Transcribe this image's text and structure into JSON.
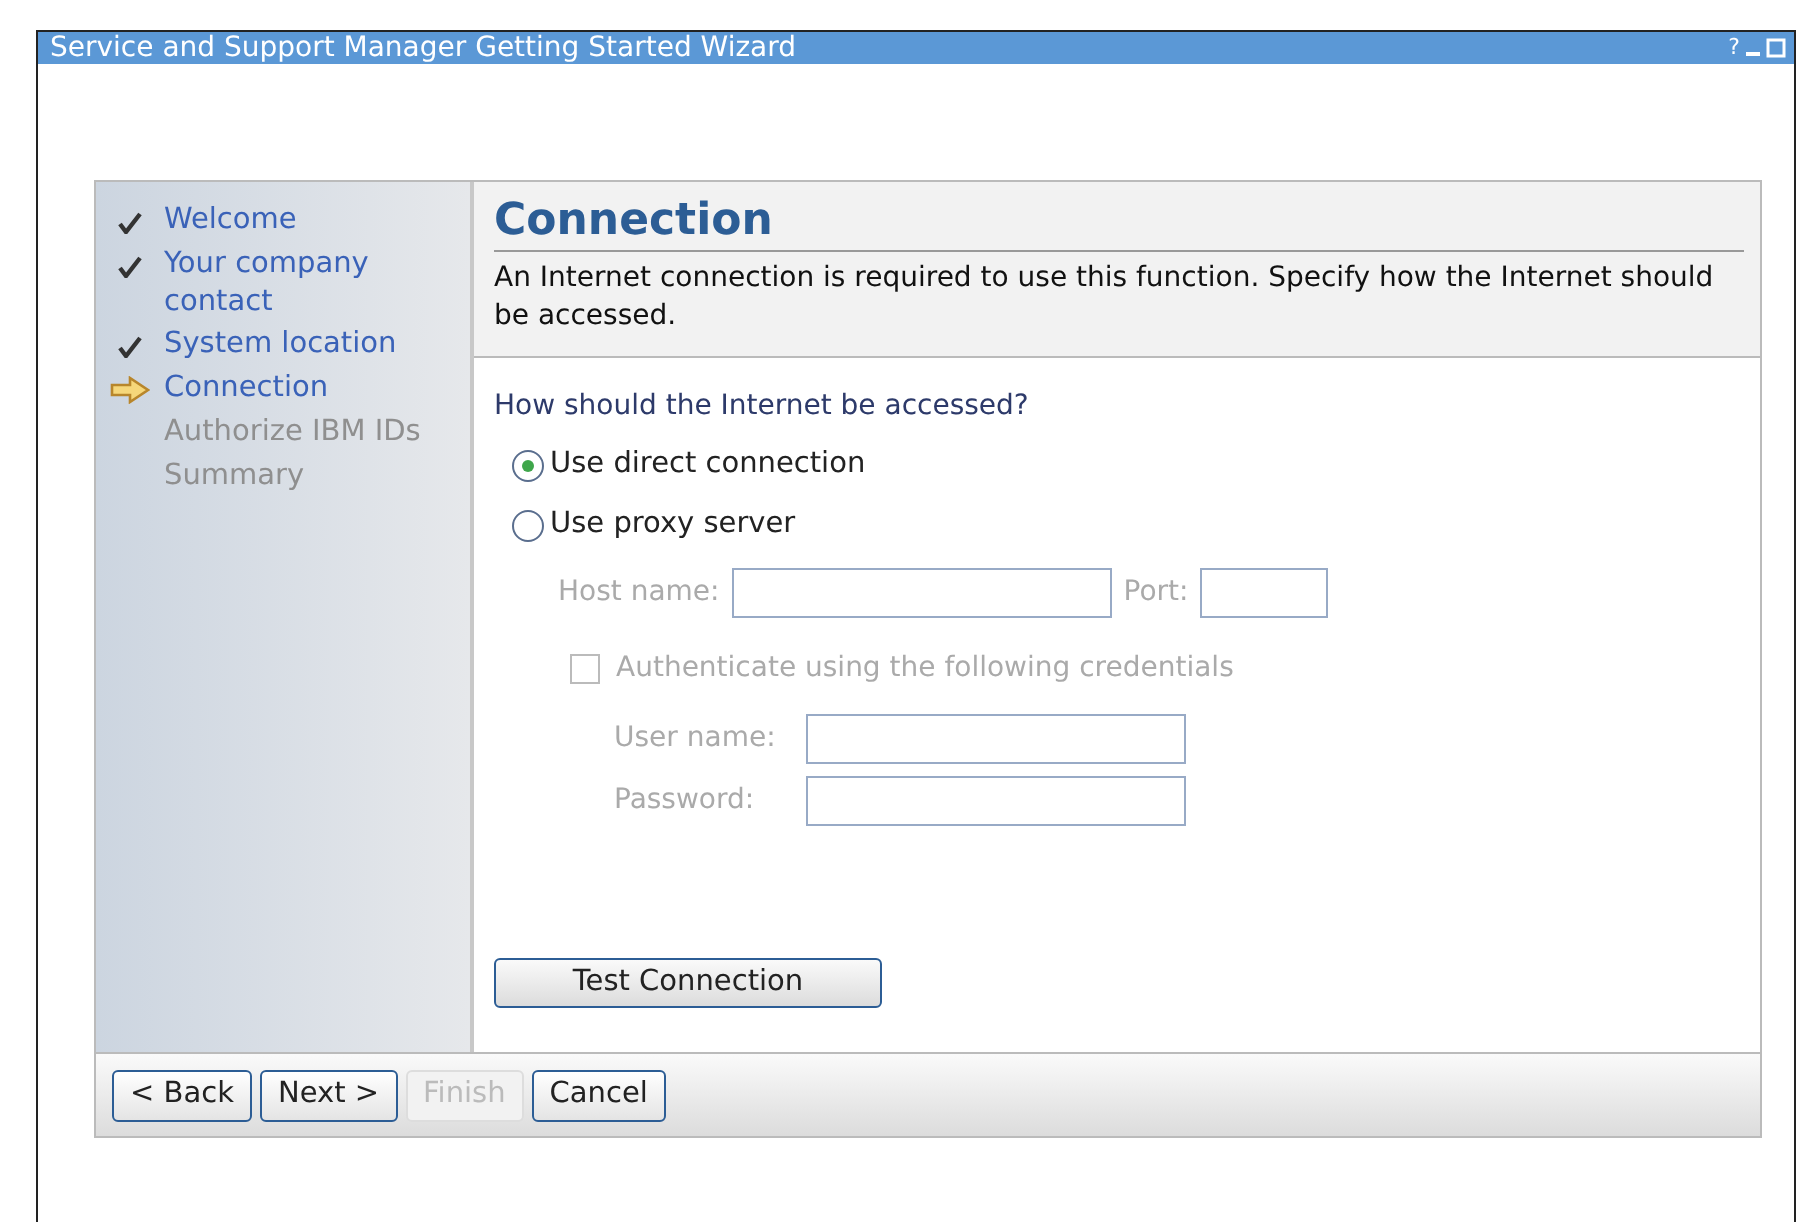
{
  "window": {
    "title": "Service and Support Manager Getting Started Wizard",
    "controls": [
      "?"
    ]
  },
  "steps": [
    {
      "label": "Welcome",
      "kind": "done"
    },
    {
      "label": "Your company contact",
      "kind": "done"
    },
    {
      "label": "System location",
      "kind": "done"
    },
    {
      "label": "Connection",
      "kind": "current"
    },
    {
      "label": "Authorize IBM IDs",
      "kind": "pending"
    },
    {
      "label": "Summary",
      "kind": "pending"
    }
  ],
  "page": {
    "heading": "Connection",
    "description": "An Internet connection is required to use this function. Specify how the Internet should be accessed."
  },
  "question": "How should the Internet be accessed?",
  "options": [
    {
      "label": "Use direct connection",
      "selected": true
    },
    {
      "label": "Use proxy server",
      "selected": false
    }
  ],
  "proxy": {
    "disabled": true,
    "host_label": "Host name:",
    "port_label": "Port:"
  },
  "auth": {
    "label": "Authenticate using the following credentials",
    "checked": false,
    "disabled": true,
    "user_label": "User name:",
    "password_label": "Password:"
  },
  "test_button": "Test Connection",
  "buttons": [
    {
      "label": "< Back",
      "disabled": false
    },
    {
      "label": "Next >",
      "disabled": false
    },
    {
      "label": "Finish",
      "disabled": true
    },
    {
      "label": "Cancel",
      "disabled": false
    }
  ]
}
